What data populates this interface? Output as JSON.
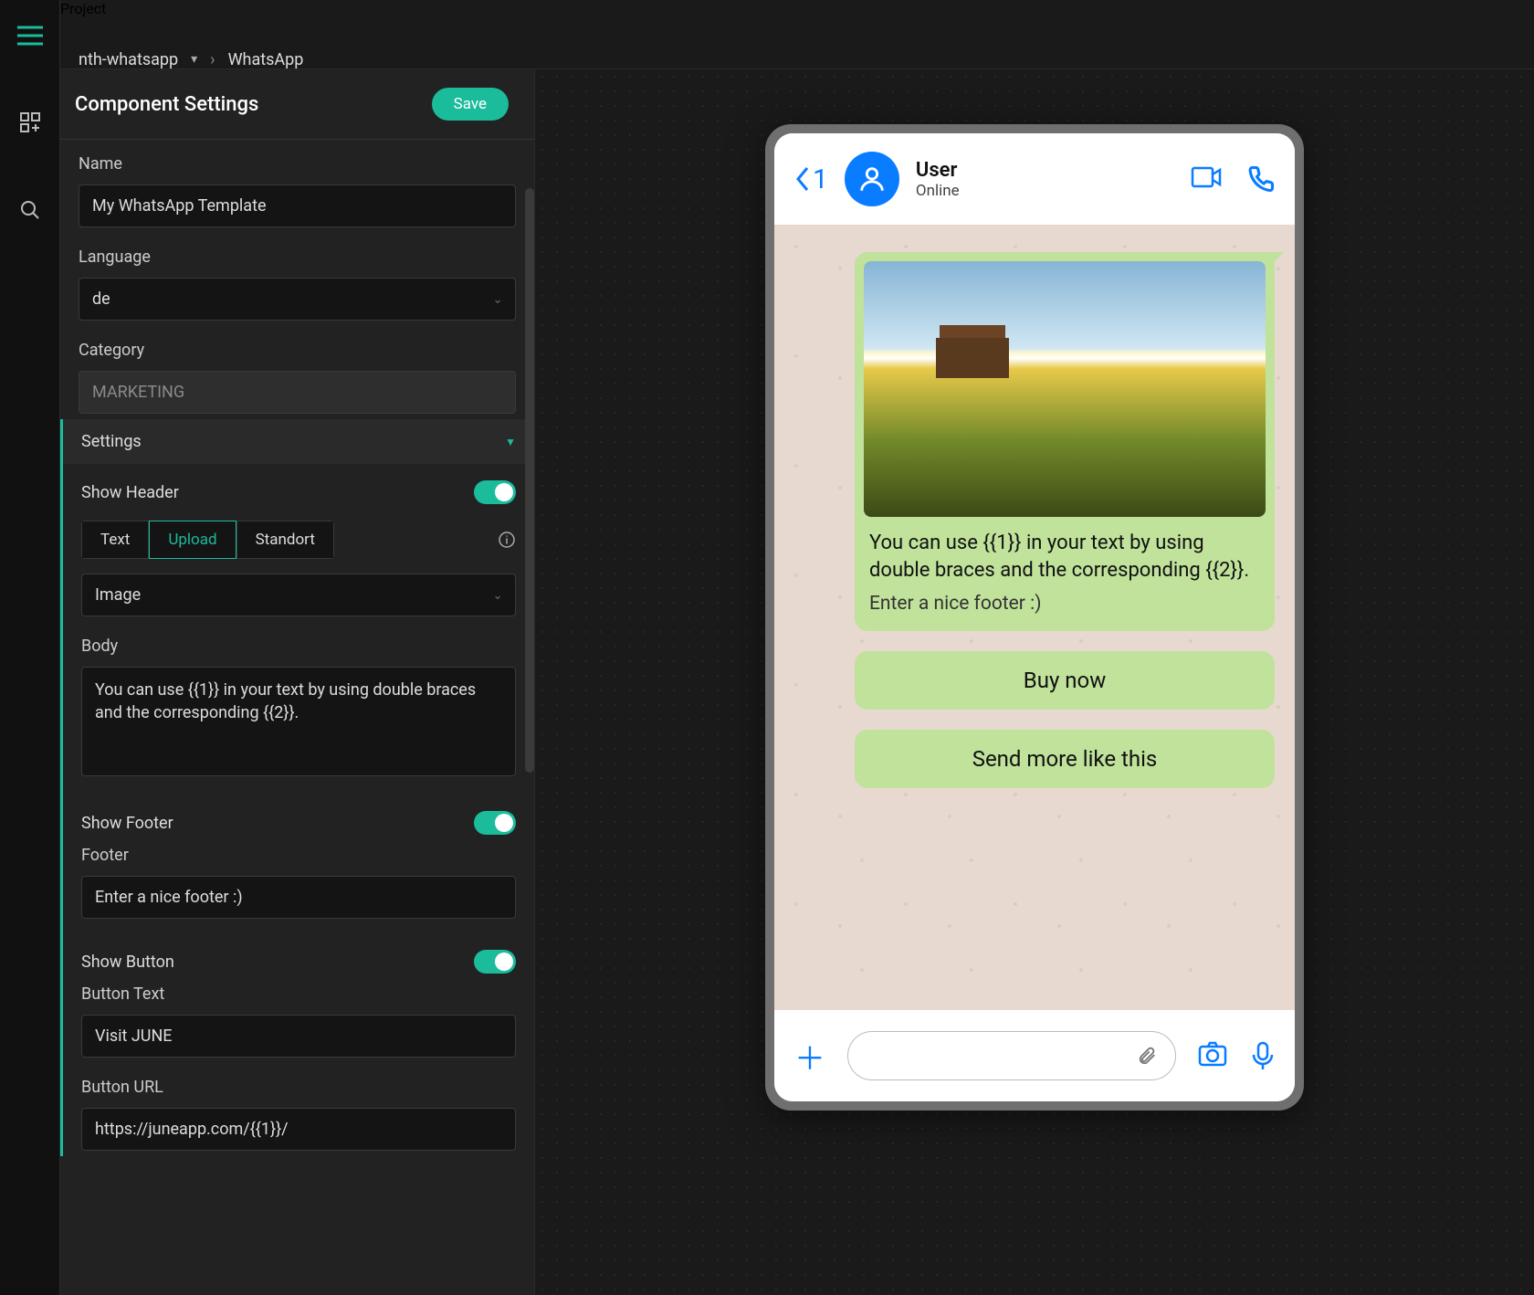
{
  "breadcrumb": {
    "projectLabel": "Project",
    "project": "nth-whatsapp",
    "page": "WhatsApp"
  },
  "panel": {
    "title": "Component Settings",
    "saveLabel": "Save",
    "name": {
      "label": "Name",
      "value": "My WhatsApp Template"
    },
    "language": {
      "label": "Language",
      "value": "de"
    },
    "category": {
      "label": "Category",
      "value": "MARKETING"
    },
    "sectionSettings": "Settings",
    "showHeader": {
      "label": "Show Header"
    },
    "headerTabs": {
      "text": "Text",
      "upload": "Upload",
      "standort": "Standort"
    },
    "headerMedia": {
      "value": "Image"
    },
    "body": {
      "label": "Body",
      "value": "You can use {{1}} in your text by using double braces and the corresponding {{2}}."
    },
    "showFooter": {
      "label": "Show Footer"
    },
    "footer": {
      "label": "Footer",
      "value": "Enter a nice footer :)"
    },
    "showButton": {
      "label": "Show Button"
    },
    "buttonText": {
      "label": "Button Text",
      "value": "Visit JUNE"
    },
    "buttonUrl": {
      "label": "Button URL",
      "value": "https://juneapp.com/{{1}}/"
    }
  },
  "preview": {
    "backCount": "1",
    "userName": "User",
    "userStatus": "Online",
    "bodyText": "You can use {{1}} in your text by using double braces and the corresponding {{2}}.",
    "footerText": "Enter a nice footer :)",
    "button1": "Buy now",
    "button2": "Send more like this"
  }
}
